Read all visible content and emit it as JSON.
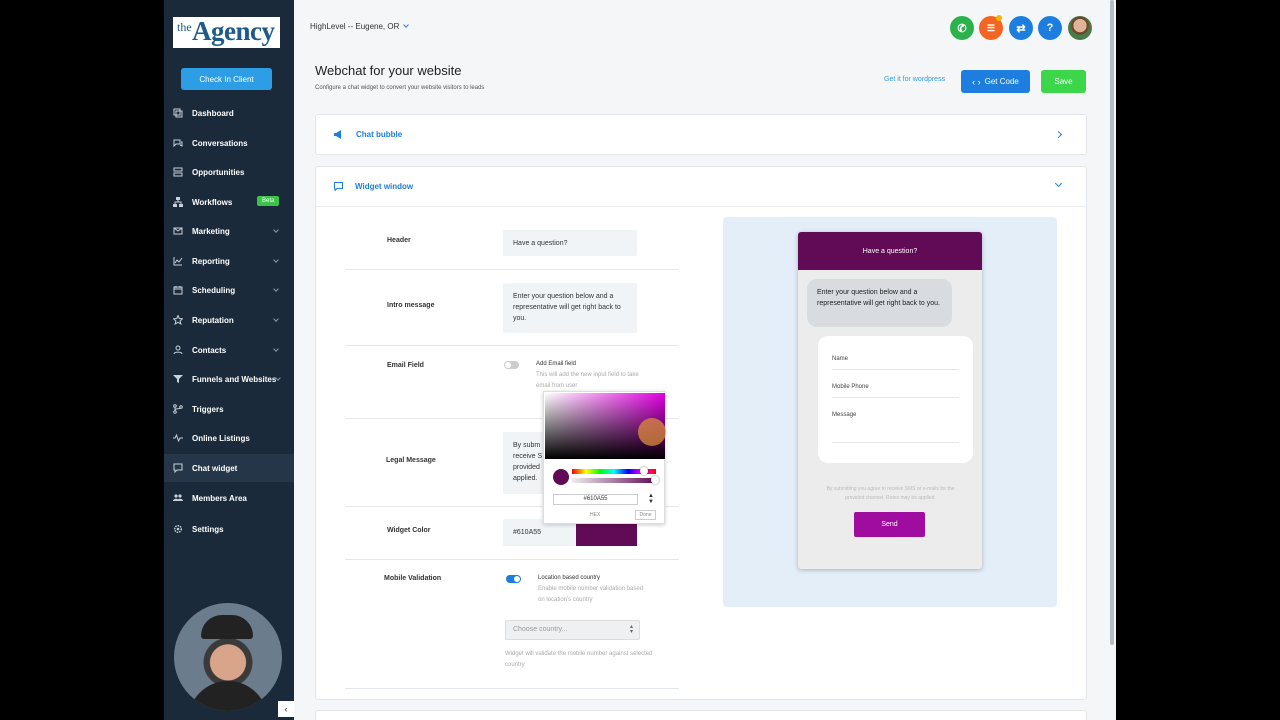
{
  "sidebar": {
    "logo_small": "the",
    "logo_big": "Agency",
    "check_in": "Check In Client",
    "items": [
      {
        "label": "Dashboard",
        "icon": "dashboard-icon"
      },
      {
        "label": "Conversations",
        "icon": "chat-bubbles-icon"
      },
      {
        "label": "Opportunities",
        "icon": "layers-icon"
      },
      {
        "label": "Workflows",
        "icon": "sitemap-icon",
        "badge": "Beta"
      },
      {
        "label": "Marketing",
        "icon": "send-icon"
      },
      {
        "label": "Reporting",
        "icon": "line-chart-icon"
      },
      {
        "label": "Scheduling",
        "icon": "calendar-icon"
      },
      {
        "label": "Reputation",
        "icon": "star-icon"
      },
      {
        "label": "Contacts",
        "icon": "user-icon"
      },
      {
        "label": "Funnels and Websites",
        "icon": "funnel-icon"
      },
      {
        "label": "Triggers",
        "icon": "branch-icon"
      },
      {
        "label": "Online Listings",
        "icon": "pulse-icon"
      },
      {
        "label": "Chat widget",
        "icon": "chat-icon"
      },
      {
        "label": "Members Area",
        "icon": "users-icon"
      },
      {
        "label": "Settings",
        "icon": "gear-icon"
      }
    ],
    "collapse": "‹"
  },
  "topbar": {
    "location": "HighLevel -- Eugene, OR",
    "buttons": {
      "phone": "✆",
      "list": "☰",
      "switch": "⇄",
      "help": "?"
    },
    "colors": {
      "phone": "#2bb24c",
      "list": "#f26522",
      "switch": "#1d7ee0",
      "help": "#1d7ee0"
    }
  },
  "page": {
    "title": "Webchat for your website",
    "subtitle": "Configure a chat widget to convert your website visitors to leads",
    "wordpress_link": "Get it for wordpress",
    "get_code": "Get Code",
    "save": "Save"
  },
  "sections": {
    "chat_bubble": "Chat bubble",
    "widget_window": "Widget window"
  },
  "form": {
    "header_label": "Header",
    "header_value": "Have a question?",
    "intro_label": "Intro message",
    "intro_value": "Enter your question below and a representative will get right back to you.",
    "email_label": "Email Field",
    "email_opt_title": "Add Email field",
    "email_opt_desc": "This will add the new input field to take email from user",
    "email_enabled": false,
    "legal_label": "Legal Message",
    "legal_lines": [
      "By subm",
      "receive S",
      "provided",
      "applied."
    ],
    "color_label": "Widget Color",
    "color_value": "#610A55",
    "mobile_label": "Mobile Validation",
    "mobile_opt_title": "Location based country",
    "mobile_opt_desc": "Enable mobile number validation based on location's country",
    "mobile_enabled": true,
    "country_placeholder": "Choose country...",
    "country_hint": "Widget will validate the mobile number against selected country"
  },
  "color_picker": {
    "hex_value": "#610A55",
    "hex_label": "HEX",
    "done": "Done",
    "accent": "#610a55"
  },
  "preview": {
    "header": "Have a question?",
    "intro": "Enter your question below and a representative will get right back to you.",
    "fields": [
      "Name",
      "Mobile Phone",
      "Message"
    ],
    "disclaimer": "By submitting you agree to receive SMS or e-mails for the provided channel. Rates may be applied.",
    "send": "Send",
    "send_color": "#a00ca0"
  }
}
